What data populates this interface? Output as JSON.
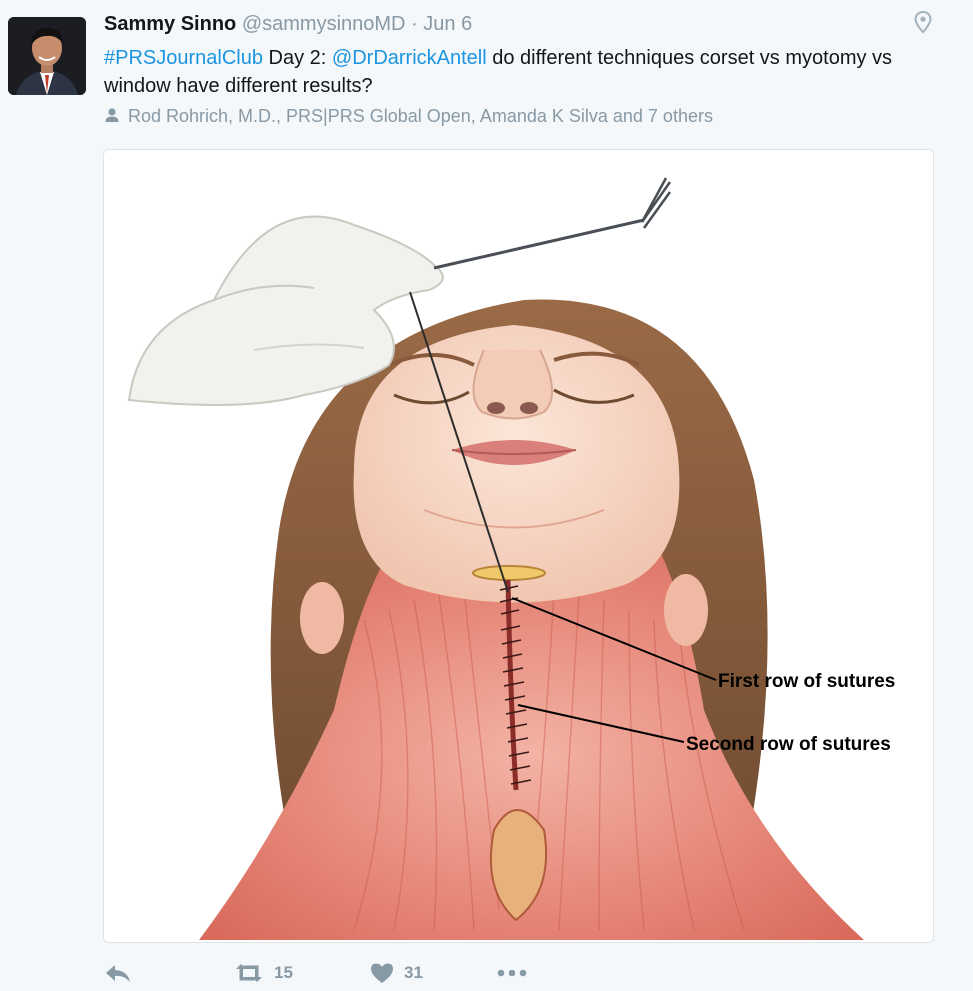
{
  "tweet": {
    "author_name": "Sammy Sinno",
    "author_handle": "@sammysinnoMD",
    "separator": "·",
    "date": "Jun 6",
    "text": {
      "hashtag": "#PRSJournalClub",
      "part1": " Day 2: ",
      "mention": "@DrDarrickAntell",
      "part2": " do different techniques corset vs myotomy vs window have different results?"
    },
    "mentioned_users": "Rod Rohrich, M.D., PRS|PRS Global Open, Amanda K Silva and 7 others"
  },
  "media": {
    "labels": {
      "first_row": "First row of sutures",
      "second_row": "Second row of sutures"
    }
  },
  "actions": {
    "retweet_count": "15",
    "like_count": "31"
  },
  "icons": {
    "avatar": "profile-photo",
    "location": "location-pin-icon",
    "mentions": "person-icon",
    "reply": "reply-icon",
    "retweet": "retweet-icon",
    "like": "heart-icon",
    "more": "more-dots-icon"
  },
  "colors": {
    "link": "#1b95e0",
    "muted": "#8899a6",
    "text": "#14171a",
    "background": "#f5f8fa"
  }
}
